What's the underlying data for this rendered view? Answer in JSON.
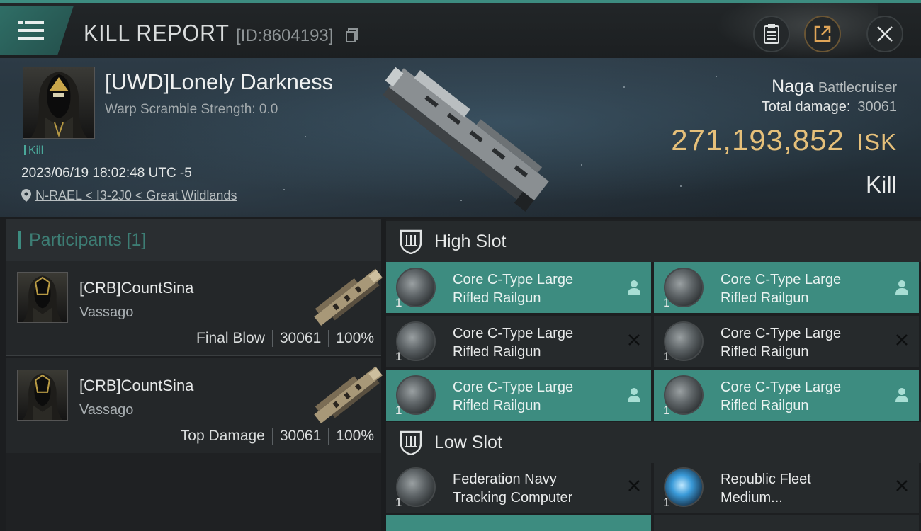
{
  "topbar": {
    "title": "KILL REPORT",
    "report_id": "[ID:8604193]",
    "buttons": [
      "menu-button",
      "clipboard-button",
      "share-button",
      "close-button"
    ]
  },
  "victim": {
    "name": "[UWD]Lonely Darkness",
    "warp_scramble": "Warp Scramble Strength: 0.0",
    "tag": "Kill",
    "datetime": "2023/06/19 18:02:48 UTC -5",
    "location": "N-RAEL < I3-2J0 < Great Wildlands",
    "ship_name": "Naga",
    "ship_class": "Battlecruiser",
    "total_damage_label": "Total damage:",
    "total_damage_value": "30061",
    "isk_value": "271,193,852",
    "isk_unit": "ISK",
    "result": "Kill"
  },
  "participants": {
    "title": "Participants [1]",
    "rows": [
      {
        "name": "[CRB]CountSina",
        "ship": "Vassago",
        "role": "Final Blow",
        "damage": "30061",
        "percent": "100%"
      },
      {
        "name": "[CRB]CountSina",
        "ship": "Vassago",
        "role": "Top Damage",
        "damage": "30061",
        "percent": "100%"
      }
    ]
  },
  "high_slot": {
    "title": "High Slot",
    "modules": [
      {
        "name_line1": "Core C-Type Large",
        "name_line2": "Rifled Railgun",
        "qty": "1",
        "status": "dropped"
      },
      {
        "name_line1": "Core C-Type Large",
        "name_line2": "Rifled Railgun",
        "qty": "1",
        "status": "dropped"
      },
      {
        "name_line1": "Core C-Type Large",
        "name_line2": "Rifled Railgun",
        "qty": "1",
        "status": "destroyed"
      },
      {
        "name_line1": "Core C-Type Large",
        "name_line2": "Rifled Railgun",
        "qty": "1",
        "status": "destroyed"
      },
      {
        "name_line1": "Core C-Type Large",
        "name_line2": "Rifled Railgun",
        "qty": "1",
        "status": "dropped"
      },
      {
        "name_line1": "Core C-Type Large",
        "name_line2": "Rifled Railgun",
        "qty": "1",
        "status": "dropped"
      }
    ]
  },
  "low_slot": {
    "title": "Low Slot",
    "modules": [
      {
        "name_line1": "Federation Navy",
        "name_line2": "Tracking Computer",
        "qty": "1",
        "status": "destroyed"
      },
      {
        "name_line1": "Republic Fleet",
        "name_line2": "Medium...",
        "qty": "1",
        "status": "destroyed"
      }
    ]
  },
  "colors": {
    "accent_teal": "#3d8c80",
    "isk_gold": "#e6c07a"
  }
}
